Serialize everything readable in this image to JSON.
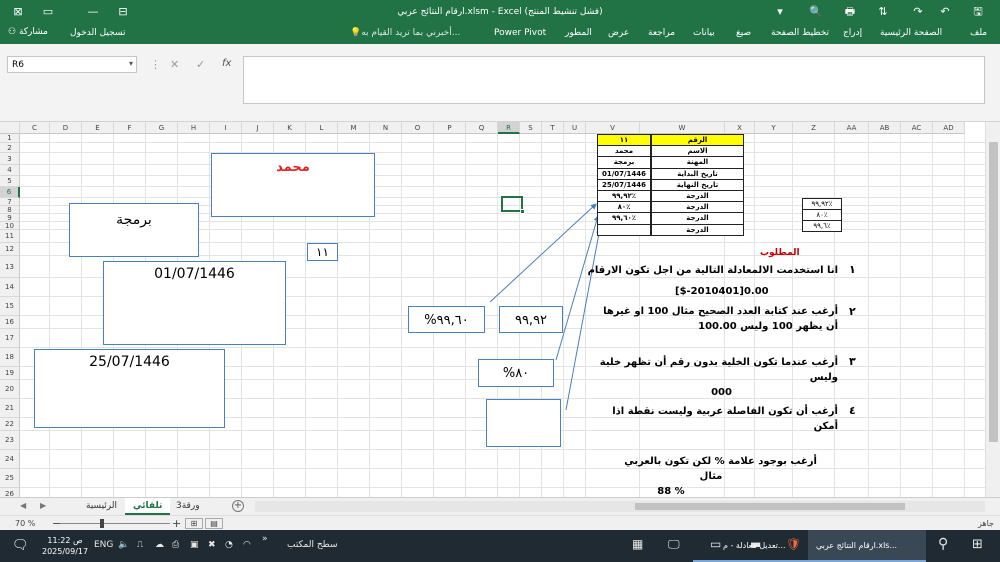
{
  "window": {
    "title": "ارقام النتائج عربي.xlsm - Excel (فشل تنشيط المنتج)",
    "icons": [
      "save-icon",
      "undo-icon",
      "redo-icon",
      "print-preview-icon",
      "ribbon-display-icon",
      "minimize-icon",
      "restore-icon",
      "close-icon"
    ]
  },
  "ribbon": {
    "tabs": [
      "ملف",
      "الصفحة الرئيسية",
      "إدراج",
      "تخطيط الصفحة",
      "صيغ",
      "بيانات",
      "مراجعة",
      "عرض",
      "المطور",
      "Power Pivot"
    ],
    "tell_me": "أخبرني بما تريد القيام به...",
    "sign_in": "تسجيل الدخول",
    "share": "مشاركة"
  },
  "formula_bar": {
    "name_box": "R6",
    "fx": "fx",
    "formula": ""
  },
  "columns": [
    "C",
    "D",
    "E",
    "F",
    "G",
    "H",
    "I",
    "J",
    "K",
    "L",
    "M",
    "N",
    "O",
    "P",
    "Q",
    "R",
    "S",
    "T",
    "U",
    "V",
    "W",
    "X",
    "Y",
    "Z",
    "AA",
    "AB",
    "AC",
    "AD"
  ],
  "rows": [
    "1",
    "2",
    "3",
    "4",
    "5",
    "6",
    "7",
    "8",
    "9",
    "10",
    "11",
    "12",
    "13",
    "14",
    "15",
    "16",
    "17",
    "18",
    "19",
    "20",
    "21",
    "22",
    "23",
    "24",
    "25",
    "26"
  ],
  "selected_cell": "R6",
  "boxes": {
    "name": "محمد",
    "job": "برمجة",
    "start_date": "01/07/1446",
    "end_date": "25/07/1446",
    "number": "١١",
    "pct_a": "%٩٩,٦٠",
    "score": "٩٩,٩٢",
    "pct_b": "%٨٠",
    "empty": ""
  },
  "info_table": {
    "headers": [
      "الرقم",
      "١١"
    ],
    "rows": [
      [
        "الاسم",
        "محمد"
      ],
      [
        "المهنة",
        "برمجة"
      ],
      [
        "تاريخ البداية",
        "01/07/1446"
      ],
      [
        "تاريخ النهاية",
        "25/07/1446"
      ],
      [
        "الدرجة",
        "٩٩,٩٢٪"
      ],
      [
        "الدرجة",
        "٨٠٪"
      ],
      [
        "الدرجة",
        "٩٩,٦٠٪"
      ],
      [
        "الدرجة",
        ""
      ]
    ]
  },
  "side_table": [
    "٩٩,٩٢٪",
    "٨٠٪",
    "٩٩,٦٪"
  ],
  "requirements": {
    "heading": "المطلوب",
    "items": [
      {
        "num": "١",
        "lines": [
          "انا استخدمت الالمعادلة التالية من اجل تكون الارقام",
          "[$-2010401]0.00"
        ]
      },
      {
        "num": "٢",
        "lines": [
          "أرغب عند كتابة العدد الصحيح مثال 100 او غيرها",
          "أن يظهر 100 وليس 100.00"
        ]
      },
      {
        "num": "٣",
        "lines": [
          "أرغب عندما تكون الخلية بدون رقم أن تظهر خلية وليس",
          "000"
        ]
      },
      {
        "num": "٤",
        "lines": [
          "أرغب أن تكون الفاصلة عربية وليست نقطة اذا أمكن"
        ]
      },
      {
        "num": "",
        "lines": [
          "أرغب بوجود علامة % لكن تكون بالعربي",
          "مثال",
          "88 %"
        ]
      }
    ]
  },
  "sheet_tabs": {
    "tabs": [
      "الرئيسية",
      "تلقائي",
      "ورقة3"
    ],
    "active": "تلقائي"
  },
  "status_bar": {
    "ready": "جاهز",
    "zoom": "70 %",
    "zoom_level_percent": 70
  },
  "taskbar": {
    "time": "11:22 ص",
    "date": "2025/09/17",
    "language": "ENG",
    "desktop": "سطح المكتب",
    "apps": [
      {
        "label": "ارقام النتائج عربي.xls...",
        "active": true
      },
      {
        "label": "تعديل معادلة - م...",
        "active": false
      }
    ]
  },
  "colors": {
    "excel_green": "#217346",
    "box_border": "#4a7fc1",
    "name_red": "#e02020",
    "highlight_yellow": "#ffff00",
    "heading_red": "#c00000"
  }
}
